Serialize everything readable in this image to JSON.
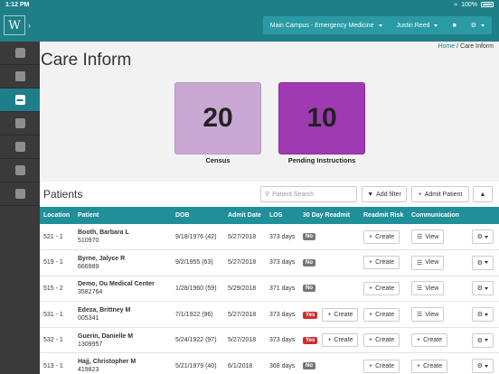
{
  "status": {
    "time": "1:12 PM",
    "battery": "100%"
  },
  "header": {
    "location_menu": "Main Campus - Emergency Medicine",
    "user_menu": "Justin Reed"
  },
  "breadcrumb": {
    "home": "Home",
    "separator": "/",
    "current": "Care Inform"
  },
  "page_title": "Care Inform",
  "tiles": [
    {
      "value": "20",
      "label": "Census",
      "color": "#c9a9d3"
    },
    {
      "value": "10",
      "label": "Pending Instructions",
      "color": "#a03ab2"
    }
  ],
  "patients": {
    "title": "Patients",
    "search_placeholder": "Patient Search",
    "filter_label": "Add filter",
    "admit_label": "Admit Patient",
    "columns": [
      "Location",
      "Patient",
      "DOB",
      "Admit Date",
      "LOS",
      "30 Day Readmit",
      "Readmit Risk",
      "Communication",
      ""
    ],
    "create_label": "Create",
    "view_label": "View",
    "rows": [
      {
        "location": "521 - 1",
        "name": "Booth, Barbara L",
        "mrn": "510970",
        "dob": "9/18/1976 (42)",
        "admit": "5/27/2018",
        "los": "373 days",
        "readmit": "No",
        "readmit_yes": false,
        "readmit_create": false,
        "risk": "Create",
        "comm": "View"
      },
      {
        "location": "519 - 1",
        "name": "Byrne, Jalyce R",
        "mrn": "666989",
        "dob": "9/2/1955 (63)",
        "admit": "5/27/2018",
        "los": "373 days",
        "readmit": "No",
        "readmit_yes": false,
        "readmit_create": false,
        "risk": "Create",
        "comm": "View"
      },
      {
        "location": "515 - 2",
        "name": "Demo, Ou Medical Center",
        "mrn": "3582764",
        "dob": "1/28/1960 (59)",
        "admit": "5/29/2018",
        "los": "371 days",
        "readmit": "No",
        "readmit_yes": false,
        "readmit_create": false,
        "risk": "Create",
        "comm": "View"
      },
      {
        "location": "531 - 1",
        "name": "Edeza, Brittney M",
        "mrn": "005341",
        "dob": "7/1/1922 (96)",
        "admit": "5/27/2018",
        "los": "373 days",
        "readmit": "Yes",
        "readmit_yes": true,
        "readmit_create": true,
        "risk": "Create",
        "comm": "View"
      },
      {
        "location": "532 - 1",
        "name": "Guerin, Danielle M",
        "mrn": "1309957",
        "dob": "5/24/1922 (97)",
        "admit": "5/27/2018",
        "los": "373 days",
        "readmit": "Yes",
        "readmit_yes": true,
        "readmit_create": true,
        "risk": "Create",
        "comm": "Create"
      },
      {
        "location": "513 - 1",
        "name": "Hajj, Christopher M",
        "mrn": "419823",
        "dob": "5/21/1979 (40)",
        "admit": "6/1/2018",
        "los": "368 days",
        "readmit": "No",
        "readmit_yes": false,
        "readmit_create": false,
        "risk": "Create",
        "comm": "Create"
      }
    ]
  }
}
